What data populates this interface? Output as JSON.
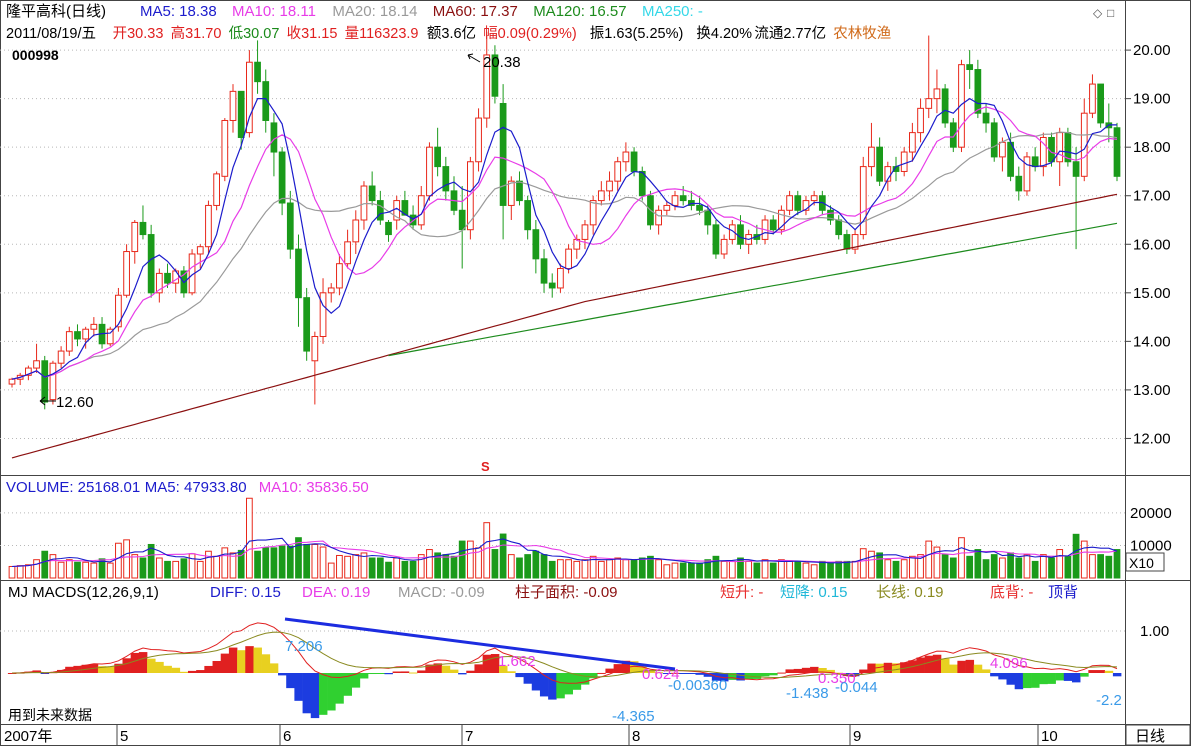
{
  "stock": {
    "name": "隆平高科(日线)",
    "code": "000998",
    "date": "2011/08/19/五",
    "sector": "农林牧渔",
    "quote": {
      "open": "开30.33",
      "high": "高31.70",
      "low": "低30.07",
      "close": "收31.15",
      "vol": "量116323.9",
      "amount": "额3.6亿",
      "change": "幅0.09(0.29%)",
      "amplitude": "振1.63(5.25%)",
      "turnover": "换4.20%",
      "float": "流通2.77亿"
    }
  },
  "ma_legend": [
    {
      "text": "MA5: 18.38",
      "color": "#1c1ccc"
    },
    {
      "text": "MA10: 18.11",
      "color": "#e83ce8"
    },
    {
      "text": "MA20: 18.14",
      "color": "#9a9a9a"
    },
    {
      "text": "MA60: 17.37",
      "color": "#8b1010"
    },
    {
      "text": "MA120: 16.57",
      "color": "#1d8b1d"
    },
    {
      "text": "MA250: -",
      "color": "#34d8e8"
    }
  ],
  "annotations": {
    "high_mark": "20.38",
    "low_mark": "12.60",
    "s_marker": "S"
  },
  "volume_legend": [
    {
      "text": "VOLUME: 25168.01",
      "color": "#1c1ccc"
    },
    {
      "text": "MA5: 47933.80",
      "color": "#1c1ccc"
    },
    {
      "text": "MA10: 35836.50",
      "color": "#e83ce8"
    }
  ],
  "volume_unit": "X10",
  "macd_legend": [
    {
      "text": "MJ  MACDS(12,26,9,1)",
      "color": "#000000"
    },
    {
      "text": "DIFF: 0.15",
      "color": "#1c1ccc"
    },
    {
      "text": "DEA: 0.19",
      "color": "#e83ce8"
    },
    {
      "text": "MACD: -0.09",
      "color": "#9a9a9a"
    },
    {
      "text": "柱子面积: -0.09",
      "color": "#8b1010"
    },
    {
      "text": "短升: -",
      "color": "#e83030"
    },
    {
      "text": "短降: 0.15",
      "color": "#20b8d8"
    },
    {
      "text": "长线: 0.19",
      "color": "#8a8a20"
    },
    {
      "text": "底背: -",
      "color": "#e83030"
    },
    {
      "text": "顶背",
      "color": "#1c1ccc"
    }
  ],
  "macd_labels": [
    {
      "text": "7.206",
      "color": "#3a9ae8"
    },
    {
      "text": "1.662",
      "color": "#e83ce8"
    },
    {
      "text": "0.624",
      "color": "#e83ce8"
    },
    {
      "text": "-0.00360",
      "color": "#3a9ae8"
    },
    {
      "text": "-1.438",
      "color": "#3a9ae8"
    },
    {
      "text": "0.350",
      "color": "#e83ce8"
    },
    {
      "text": "-0.044",
      "color": "#3a9ae8"
    },
    {
      "text": "4.096",
      "color": "#e83ce8"
    },
    {
      "text": "-2.2",
      "color": "#3a9ae8"
    },
    {
      "text": "-4.365",
      "color": "#3a9ae8"
    }
  ],
  "future_text": "用到未来数据",
  "macd_tick": "1.00",
  "month_axis": [
    "2007年",
    "5",
    "6",
    "7",
    "8",
    "9",
    "10"
  ],
  "period_label": "日线",
  "chart_data": [
    {
      "type": "candlestick",
      "y_ticks": [
        "12.00",
        "13.00",
        "14.00",
        "15.00",
        "16.00",
        "17.00",
        "18.00",
        "19.00",
        "20.00"
      ],
      "ylim": [
        11.35,
        20.62
      ],
      "candles": [
        [
          13.12,
          13.25,
          13.05,
          13.22
        ],
        [
          13.22,
          13.35,
          13.1,
          13.3
        ],
        [
          13.3,
          13.5,
          13.2,
          13.45
        ],
        [
          13.45,
          13.95,
          13.35,
          13.6
        ],
        [
          13.6,
          13.7,
          12.6,
          12.75
        ],
        [
          12.8,
          13.6,
          12.7,
          13.55
        ],
        [
          13.55,
          13.9,
          13.45,
          13.8
        ],
        [
          13.8,
          14.3,
          13.7,
          14.2
        ],
        [
          14.2,
          14.35,
          13.9,
          14.05
        ],
        [
          14.05,
          14.3,
          13.85,
          14.25
        ],
        [
          14.25,
          14.5,
          14.1,
          14.35
        ],
        [
          14.35,
          14.5,
          13.85,
          13.95
        ],
        [
          13.95,
          14.3,
          13.9,
          14.25
        ],
        [
          14.3,
          15.1,
          14.2,
          14.95
        ],
        [
          14.95,
          16.0,
          14.9,
          15.85
        ],
        [
          15.85,
          16.5,
          15.6,
          16.45
        ],
        [
          16.45,
          16.8,
          16.1,
          16.2
        ],
        [
          16.2,
          16.4,
          14.9,
          15.0
        ],
        [
          15.0,
          15.5,
          14.8,
          15.4
        ],
        [
          15.4,
          15.6,
          15.1,
          15.2
        ],
        [
          15.2,
          15.5,
          15.0,
          15.45
        ],
        [
          15.45,
          15.55,
          14.9,
          15.0
        ],
        [
          15.0,
          15.9,
          14.95,
          15.8
        ],
        [
          15.8,
          16.0,
          15.5,
          15.95
        ],
        [
          15.95,
          16.9,
          15.8,
          16.8
        ],
        [
          16.8,
          17.5,
          16.7,
          17.45
        ],
        [
          17.4,
          18.6,
          17.3,
          18.55
        ],
        [
          18.55,
          19.3,
          18.3,
          19.15
        ],
        [
          19.15,
          19.1,
          17.95,
          18.2
        ],
        [
          18.3,
          20.0,
          18.2,
          19.75
        ],
        [
          19.75,
          20.2,
          19.1,
          19.35
        ],
        [
          19.35,
          19.6,
          18.3,
          18.55
        ],
        [
          18.5,
          18.7,
          17.4,
          17.9
        ],
        [
          17.9,
          18.0,
          16.6,
          16.85
        ],
        [
          16.85,
          17.1,
          15.7,
          15.9
        ],
        [
          15.9,
          16.2,
          14.3,
          14.9
        ],
        [
          14.9,
          15.1,
          13.6,
          13.8
        ],
        [
          13.6,
          14.2,
          12.7,
          14.1
        ],
        [
          14.1,
          15.3,
          13.95,
          15.0
        ],
        [
          15.0,
          15.2,
          14.8,
          15.1
        ],
        [
          15.1,
          15.8,
          14.95,
          15.6
        ],
        [
          15.6,
          16.3,
          15.5,
          16.05
        ],
        [
          16.05,
          16.7,
          15.8,
          16.5
        ],
        [
          16.5,
          17.3,
          16.3,
          17.2
        ],
        [
          17.2,
          17.5,
          16.8,
          16.9
        ],
        [
          16.9,
          17.1,
          16.4,
          16.5
        ],
        [
          16.45,
          16.5,
          16.05,
          16.2
        ],
        [
          16.5,
          17.0,
          16.3,
          16.9
        ],
        [
          16.9,
          17.1,
          16.6,
          16.6
        ],
        [
          16.6,
          16.8,
          16.3,
          16.4
        ],
        [
          16.4,
          17.2,
          16.3,
          17.0
        ],
        [
          17.0,
          18.1,
          16.9,
          18.0
        ],
        [
          18.0,
          18.4,
          17.4,
          17.6
        ],
        [
          17.6,
          17.8,
          16.9,
          17.1
        ],
        [
          17.1,
          17.4,
          16.6,
          16.7
        ],
        [
          16.7,
          17.2,
          15.5,
          16.3
        ],
        [
          16.3,
          17.8,
          16.1,
          17.7
        ],
        [
          17.7,
          18.8,
          17.5,
          18.6
        ],
        [
          18.6,
          20.38,
          18.4,
          19.9
        ],
        [
          19.9,
          20.1,
          18.9,
          19.05
        ],
        [
          18.9,
          19.3,
          16.1,
          16.8
        ],
        [
          16.8,
          17.4,
          16.5,
          17.3
        ],
        [
          17.3,
          17.5,
          16.8,
          16.9
        ],
        [
          16.9,
          17.0,
          16.1,
          16.3
        ],
        [
          16.3,
          16.5,
          15.4,
          15.7
        ],
        [
          15.7,
          15.9,
          15.0,
          15.2
        ],
        [
          15.2,
          15.4,
          14.9,
          15.1
        ],
        [
          15.1,
          15.6,
          15.0,
          15.5
        ],
        [
          15.5,
          16.0,
          15.4,
          15.9
        ],
        [
          15.9,
          16.2,
          15.7,
          16.1
        ],
        [
          16.1,
          16.5,
          15.9,
          16.4
        ],
        [
          16.4,
          17.0,
          16.2,
          16.9
        ],
        [
          16.9,
          17.3,
          16.8,
          17.1
        ],
        [
          17.1,
          17.5,
          16.9,
          17.3
        ],
        [
          17.3,
          17.8,
          17.1,
          17.7
        ],
        [
          17.7,
          18.1,
          17.5,
          17.9
        ],
        [
          17.9,
          18.0,
          17.4,
          17.5
        ],
        [
          17.5,
          17.6,
          16.9,
          17.0
        ],
        [
          17.0,
          17.1,
          16.3,
          16.4
        ],
        [
          16.4,
          16.8,
          16.2,
          16.7
        ],
        [
          16.7,
          16.9,
          16.6,
          16.8
        ],
        [
          16.8,
          17.1,
          16.7,
          17.0
        ],
        [
          17.0,
          17.2,
          16.8,
          16.9
        ],
        [
          16.9,
          17.1,
          16.7,
          16.8
        ],
        [
          16.8,
          17.0,
          16.6,
          16.7
        ],
        [
          16.7,
          16.8,
          16.2,
          16.4
        ],
        [
          16.4,
          16.5,
          15.7,
          15.8
        ],
        [
          15.8,
          16.2,
          15.7,
          16.1
        ],
        [
          16.1,
          16.5,
          16.0,
          16.4
        ],
        [
          16.4,
          16.6,
          15.9,
          16.0
        ],
        [
          16.0,
          16.3,
          15.8,
          16.2
        ],
        [
          16.2,
          16.4,
          16.0,
          16.1
        ],
        [
          16.1,
          16.6,
          16.0,
          16.5
        ],
        [
          16.5,
          16.6,
          16.2,
          16.3
        ],
        [
          16.3,
          16.8,
          16.2,
          16.7
        ],
        [
          16.7,
          17.1,
          16.6,
          17.0
        ],
        [
          17.0,
          17.1,
          16.6,
          16.7
        ],
        [
          16.7,
          17.0,
          16.6,
          16.9
        ],
        [
          16.9,
          17.1,
          16.8,
          17.0
        ],
        [
          17.0,
          17.1,
          16.6,
          16.7
        ],
        [
          16.7,
          16.8,
          16.4,
          16.5
        ],
        [
          16.5,
          16.6,
          16.1,
          16.2
        ],
        [
          16.2,
          16.3,
          15.8,
          15.9
        ],
        [
          15.9,
          16.3,
          15.8,
          16.2
        ],
        [
          16.2,
          17.8,
          16.1,
          17.6
        ],
        [
          17.6,
          18.5,
          17.4,
          18.0
        ],
        [
          18.0,
          18.2,
          17.2,
          17.3
        ],
        [
          17.3,
          17.7,
          17.1,
          17.6
        ],
        [
          17.6,
          17.8,
          17.3,
          17.5
        ],
        [
          17.5,
          18.0,
          17.4,
          17.9
        ],
        [
          17.9,
          18.5,
          17.7,
          18.3
        ],
        [
          18.3,
          19.0,
          18.1,
          18.8
        ],
        [
          18.8,
          20.3,
          18.6,
          19.0
        ],
        [
          19.0,
          19.6,
          18.7,
          19.2
        ],
        [
          19.2,
          19.3,
          18.4,
          18.5
        ],
        [
          18.5,
          18.6,
          17.9,
          18.0
        ],
        [
          18.0,
          19.8,
          17.9,
          19.7
        ],
        [
          19.7,
          20.0,
          19.2,
          19.6
        ],
        [
          19.6,
          19.8,
          18.6,
          18.7
        ],
        [
          18.7,
          18.9,
          18.3,
          18.5
        ],
        [
          18.5,
          18.6,
          17.7,
          17.8
        ],
        [
          17.8,
          18.2,
          17.5,
          18.1
        ],
        [
          18.1,
          18.3,
          17.3,
          17.4
        ],
        [
          17.4,
          17.6,
          16.9,
          17.1
        ],
        [
          17.1,
          17.9,
          17.0,
          17.8
        ],
        [
          17.8,
          18.0,
          17.5,
          17.6
        ],
        [
          17.6,
          18.3,
          17.4,
          18.2
        ],
        [
          18.2,
          18.3,
          17.6,
          17.7
        ],
        [
          17.7,
          18.4,
          17.2,
          18.3
        ],
        [
          18.3,
          18.4,
          17.6,
          17.7
        ],
        [
          17.7,
          18.0,
          15.9,
          17.4
        ],
        [
          17.4,
          19.0,
          17.3,
          18.7
        ],
        [
          18.7,
          19.5,
          18.6,
          19.3
        ],
        [
          19.3,
          19.3,
          18.4,
          18.5
        ],
        [
          18.5,
          18.9,
          18.1,
          18.4
        ],
        [
          18.4,
          18.5,
          17.3,
          17.4
        ]
      ]
    },
    {
      "type": "bar",
      "name": "VOLUME",
      "y_ticks": [
        "10000",
        "20000"
      ],
      "ylim": [
        0,
        25500
      ]
    },
    {
      "type": "bar",
      "name": "MACDS",
      "y_ticks": [
        "1.00"
      ]
    }
  ]
}
